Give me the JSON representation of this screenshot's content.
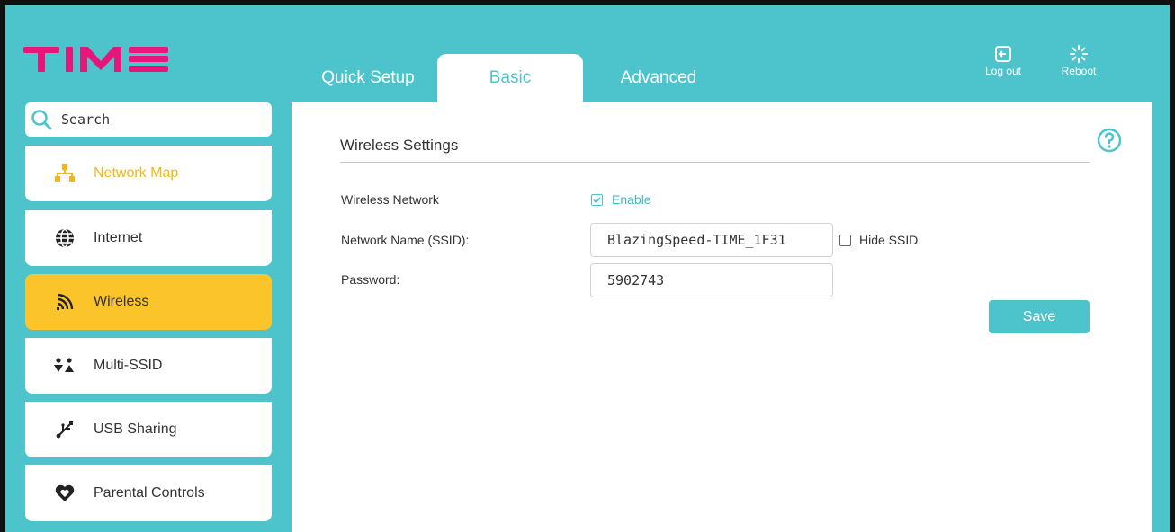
{
  "brand": {
    "logo_text": "TIME",
    "accent": "#4dc4cc",
    "logo_color": "#e6167a",
    "active_color": "#fbc42b"
  },
  "tabs": [
    {
      "label": "Quick Setup",
      "active": false
    },
    {
      "label": "Basic",
      "active": true
    },
    {
      "label": "Advanced",
      "active": false
    }
  ],
  "top_actions": [
    {
      "label": "Log out",
      "icon": "logout-icon"
    },
    {
      "label": "Reboot",
      "icon": "reboot-icon"
    }
  ],
  "search": {
    "label": "Search",
    "icon": "search-icon"
  },
  "sidebar": {
    "items": [
      {
        "label": "Network Map",
        "icon": "network-map-icon",
        "active": false
      },
      {
        "label": "Internet",
        "icon": "globe-icon",
        "active": false
      },
      {
        "label": "Wireless",
        "icon": "wifi-icon",
        "active": true
      },
      {
        "label": "Multi-SSID",
        "icon": "users-icon",
        "active": false
      },
      {
        "label": "USB Sharing",
        "icon": "usb-icon",
        "active": false
      },
      {
        "label": "Parental Controls",
        "icon": "heart-icon",
        "active": false
      }
    ]
  },
  "main": {
    "section_title": "Wireless Settings",
    "wireless_network_label": "Wireless Network",
    "enable_label": "Enable",
    "enable_checked": true,
    "ssid_label": "Network Name (SSID):",
    "ssid_value": "BlazingSpeed-TIME_1F31",
    "hide_ssid_label": "Hide SSID",
    "hide_ssid_checked": false,
    "password_label": "Password:",
    "password_value": "5902743",
    "save_label": "Save"
  }
}
